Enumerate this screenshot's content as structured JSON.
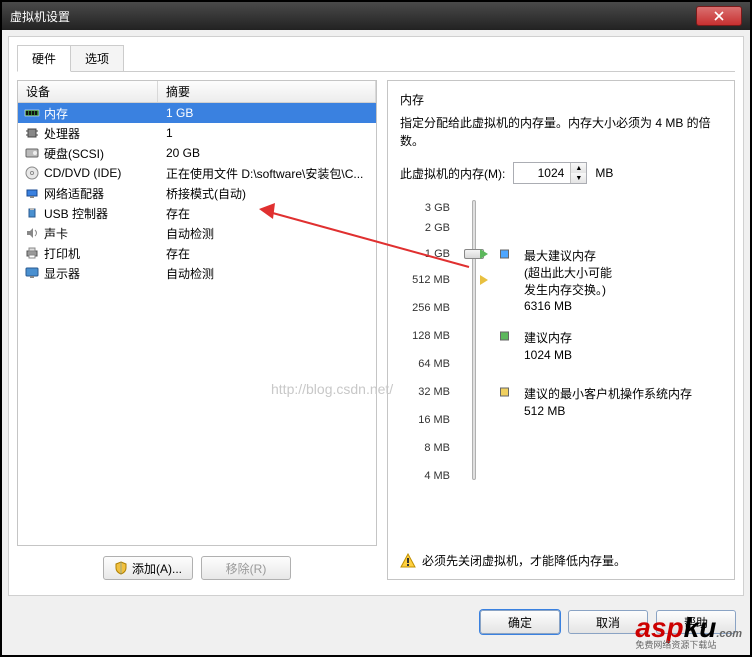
{
  "window": {
    "title": "虚拟机设置"
  },
  "tabs": {
    "hardware": "硬件",
    "options": "选项"
  },
  "table": {
    "head_device": "设备",
    "head_summary": "摘要",
    "rows": [
      {
        "name": "内存",
        "summary": "1 GB",
        "icon": "memory"
      },
      {
        "name": "处理器",
        "summary": "1",
        "icon": "cpu"
      },
      {
        "name": "硬盘(SCSI)",
        "summary": "20 GB",
        "icon": "disk"
      },
      {
        "name": "CD/DVD (IDE)",
        "summary": "正在使用文件 D:\\software\\安装包\\C...",
        "icon": "cd"
      },
      {
        "name": "网络适配器",
        "summary": "桥接模式(自动)",
        "icon": "net"
      },
      {
        "name": "USB 控制器",
        "summary": "存在",
        "icon": "usb"
      },
      {
        "name": "声卡",
        "summary": "自动检测",
        "icon": "sound"
      },
      {
        "name": "打印机",
        "summary": "存在",
        "icon": "printer"
      },
      {
        "name": "显示器",
        "summary": "自动检测",
        "icon": "display"
      }
    ]
  },
  "left_buttons": {
    "add": "添加(A)...",
    "remove": "移除(R)"
  },
  "right": {
    "title": "内存",
    "desc": "指定分配给此虚拟机的内存量。内存大小必须为 4 MB 的倍数。",
    "mem_label": "此虚拟机的内存(M):",
    "mem_value": "1024",
    "mem_unit": "MB",
    "ticks": [
      "3 GB",
      "2 GB",
      "1 GB",
      "512 MB",
      "256 MB",
      "128 MB",
      "64 MB",
      "32 MB",
      "16 MB",
      "8 MB",
      "4 MB"
    ],
    "note_max_title": "最大建议内存",
    "note_max_sub1": "(超出此大小可能",
    "note_max_sub2": "发生内存交换。)",
    "note_max_val": "6316 MB",
    "note_rec_title": "建议内存",
    "note_rec_val": "1024 MB",
    "note_min_title": "建议的最小客户机操作系统内存",
    "note_min_val": "512 MB",
    "warn": "必须先关闭虚拟机，才能降低内存量。"
  },
  "dlg": {
    "ok": "确定",
    "cancel": "取消",
    "help": "帮助"
  },
  "watermark": "http://blog.csdn.net/",
  "brand": {
    "main1": "asp",
    "main2": "ku",
    "suffix": ".com",
    "sub": "免费网络资源下载站"
  },
  "colors": {
    "sel": "#3a81e0",
    "blue_sq": "#4da6ff",
    "green_sq": "#5cb85c",
    "yellow_sq": "#f0d060",
    "yellow_tri": "#e8c040",
    "green_tri": "#5cb85c"
  }
}
